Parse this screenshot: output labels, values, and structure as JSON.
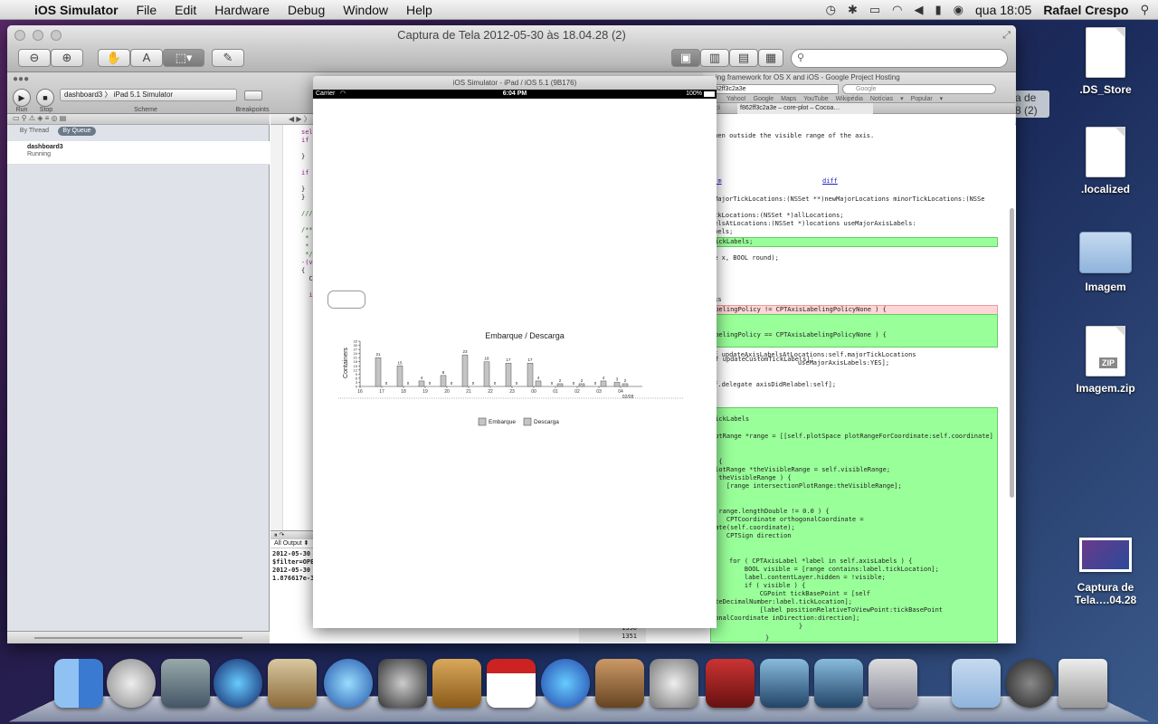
{
  "menubar": {
    "app_name": "iOS Simulator",
    "menus": [
      "File",
      "Edit",
      "Hardware",
      "Debug",
      "Window",
      "Help"
    ],
    "clock": "qua 18:05",
    "user": "Rafael Crespo"
  },
  "desktop": {
    "icons": [
      {
        "label": ".DS_Store"
      },
      {
        "label": ".localized"
      },
      {
        "label": "Imagem"
      },
      {
        "label": "Imagem.zip",
        "badge": "ZIP"
      },
      {
        "label": "Captura de Tela….04.28"
      }
    ],
    "partial_label": "a de\n8 (2)"
  },
  "preview": {
    "title": "Captura de Tela 2012-05-30 às 18.04.28 (2)",
    "search_placeholder": ""
  },
  "xcode": {
    "run_label": "Run",
    "stop_label": "Stop",
    "scheme_label": "Scheme",
    "breakpoints_label": "Breakpoints",
    "scheme_value": "dashboard3  〉 iPad 5.1 Simulator",
    "by_thread": "By Thread",
    "by_queue": "By Queue",
    "process_name": "dashboard3",
    "process_state": "Running",
    "console_filter": "All Output ⬍",
    "console_lines": [
      "2012-05-30",
      "$filter=OPE",
      "2012-05-30",
      "1.876617e-3"
    ],
    "code_lines": [
      "sel",
      "if",
      "}",
      "if",
      "}",
      "}",
      "/// @co",
      "/**",
      " *  @i",
      " *  @b",
      " */",
      "-(void)",
      "{",
      "CPT",
      "if"
    ]
  },
  "browser": {
    "window_title": "ing framework for OS X and iOS - Google Project Hosting",
    "url": "62ff3c2a3e",
    "search_placeholder": "Google",
    "bookmarks": [
      "Yahoo!",
      "Google Maps",
      "YouTube",
      "Wikipédia",
      "Notícias ▾",
      "Popular ▾"
    ],
    "tab_label": "f862ff3c2a3e – core-plot – Cocoa…",
    "tab_left": "di",
    "diff_link_left": "n.m",
    "diff_link_right": "diff",
    "lines": [
      "when outside the visible range of the axis.",
      "lMajorTickLocations:(NSSet **)newMajorLocations minorTickLocations:(NSSe",
      "s;",
      "ickLocations:(NSSet *)allLocations;",
      "belsAtLocations:(NSSet *)locations useMajorAxisLabels:",
      "abels;",
      "TickLabels;",
      "le x, BOOL round);",
      "cks",
      "abelingPolicy != CPTAxisLabelingPolicyNone ) {",
      "abelingPolicy == CPTAxisLabelingPolicyNone ) {",
      "lf updateCustomTickLabels];",
      "lf updateAxisLabelsAtLocations:self.majorTickLocations",
      "                       useMajorAxisLabels:YES];",
      "lf.delegate axisDidRelabel:self];",
      "TickLabels",
      "lotRange *range = [[self.plotSpace plotRangeForCoordinate:self.coordinate]",
      ") {",
      "PlotRange *theVisibleRange = self.visibleRange;",
      "( theVisibleRange ) {",
      "    [range intersectionPlotRange:theVisibleRange];",
      "( range.lengthDouble != 0.0 ) {",
      "    CPTCoordinate orthogonalCoordinate =",
      "nate(self.coordinate);",
      "    CPTSign direction",
      "for ( CPTAxisLabel *label in self.axisLabels ) {",
      "    BOOL visible = [range contains:label.tickLocation];",
      "    label.contentLayer.hidden = !visible;",
      "    if ( visible ) {",
      "        CGPoint tickBasePoint = [self",
      "ateDecimalNumber:label.tickLocation];",
      "        [label positionRelativeToViewPoint:tickBasePoint",
      "gonalCoordinate inDirection:direction];",
      "    }",
      "}"
    ],
    "line_numbers": [
      "1350",
      "1351"
    ]
  },
  "simulator": {
    "title": "iOS Simulator - iPad / iOS 5.1 (9B176)",
    "carrier": "Carrier",
    "time": "6:04 PM",
    "battery": "100%"
  },
  "chart_data": {
    "type": "bar",
    "title": "Embarque / Descarga",
    "ylabel": "Containers",
    "xlabel": "",
    "x_group_label": "02/08",
    "categories": [
      "16",
      "17",
      "18",
      "19",
      "20",
      "21",
      "22",
      "23",
      "00",
      "01",
      "02",
      "03",
      "04"
    ],
    "yticks": [
      "0",
      "3",
      "6",
      "9",
      "12",
      "15",
      "18",
      "21",
      "24",
      "27",
      "30",
      "33"
    ],
    "ylim": [
      0,
      33
    ],
    "series": [
      {
        "name": "Embarque",
        "values": [
          null,
          21,
          15,
          4,
          8,
          23,
          18,
          17,
          17,
          0,
          0,
          0,
          3
        ]
      },
      {
        "name": "Descarga",
        "values": [
          null,
          0,
          0,
          0,
          0,
          0,
          0,
          0,
          4,
          2,
          2,
          4,
          2
        ]
      }
    ],
    "legend_position": "bottom",
    "colors": {
      "bar_fill": "#c4c4c4",
      "bar_stroke": "#555555"
    }
  }
}
